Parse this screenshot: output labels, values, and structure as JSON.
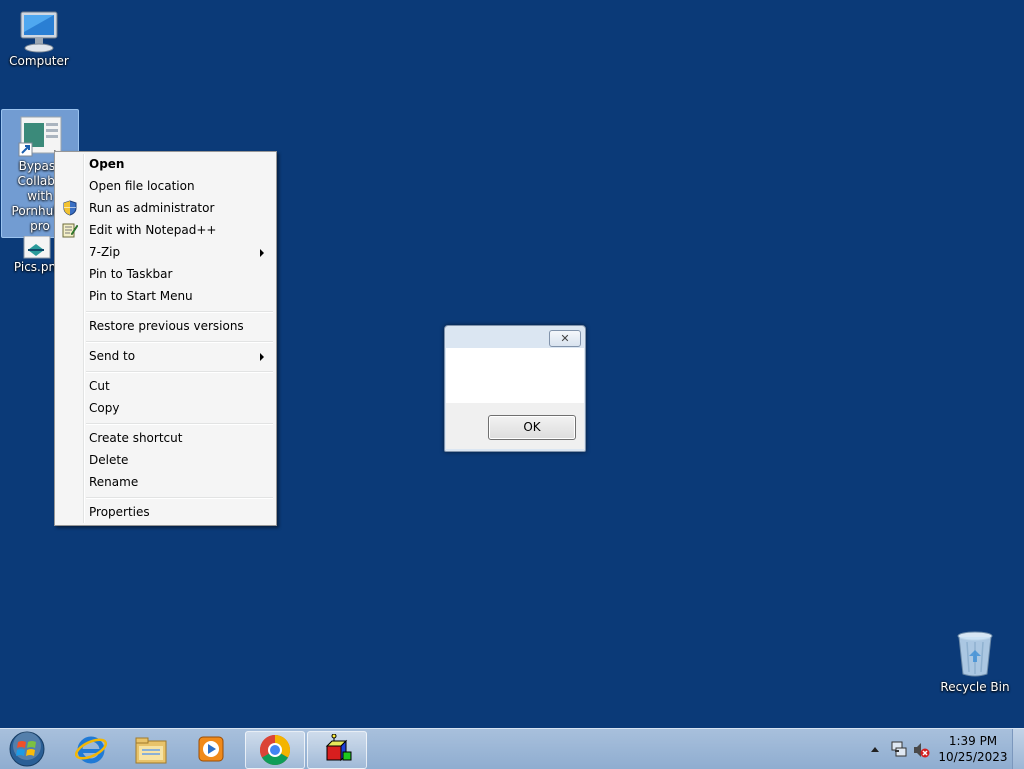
{
  "desktop": {
    "icons": [
      {
        "label": "Computer"
      },
      {
        "label_lines": [
          "Bypass",
          "Collabn",
          "with",
          "Pornhub2",
          "pro"
        ]
      },
      {
        "label": "Pics.pn"
      },
      {
        "label": "Recycle Bin"
      }
    ]
  },
  "context_menu": {
    "items": [
      {
        "label": "Open"
      },
      {
        "label": "Open file location"
      },
      {
        "label": "Run as administrator",
        "icon": "shield-icon"
      },
      {
        "label": "Edit with Notepad++",
        "icon": "notepadpp-icon"
      },
      {
        "label": "7-Zip",
        "submenu": true
      },
      {
        "label": "Pin to Taskbar"
      },
      {
        "label": "Pin to Start Menu"
      },
      {
        "label": "Restore previous versions"
      },
      {
        "label": "Send to",
        "submenu": true
      },
      {
        "label": "Cut"
      },
      {
        "label": "Copy"
      },
      {
        "label": "Create shortcut"
      },
      {
        "label": "Delete"
      },
      {
        "label": "Rename"
      },
      {
        "label": "Properties"
      }
    ]
  },
  "dialog": {
    "close_glyph": "✕",
    "ok_label": "OK"
  },
  "taskbar": {
    "apps": [
      "start-orb-icon",
      "internet-explorer-icon",
      "windows-explorer-icon",
      "media-player-icon",
      "chrome-icon",
      "3d-blocks-app-icon"
    ],
    "clock": {
      "time": "1:39 PM",
      "date": "10/25/2023"
    }
  },
  "colors": {
    "desktop": "#0b3a78",
    "taskbar": "#9db7d6",
    "selection": "#96bef0"
  }
}
